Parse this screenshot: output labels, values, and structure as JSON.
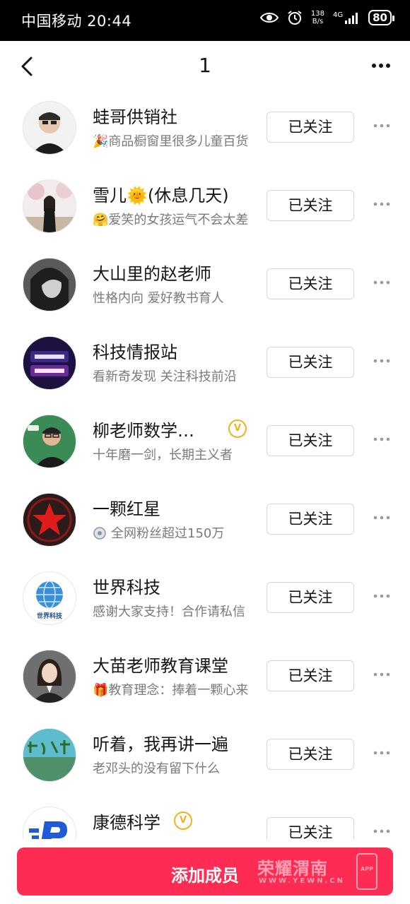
{
  "status_bar": {
    "carrier_time": "中国移动 20:44",
    "net_speed_value": "138",
    "net_speed_unit": "B/s",
    "net_type": "4G",
    "battery": "80"
  },
  "header": {
    "title": "1"
  },
  "accent_color": "#fe2c55",
  "users": [
    {
      "name": "蛙哥供销社",
      "desc": "🎉商品橱窗里很多儿童百货",
      "follow": "已关注",
      "avatar": "person-avatar"
    },
    {
      "name": "雪儿🌞(休息几天)",
      "desc": "🤗爱笑的女孩运气不会太差",
      "follow": "已关注",
      "avatar": "person-avatar"
    },
    {
      "name": "大山里的赵老师",
      "desc": "性格内向 爱好教书育人",
      "follow": "已关注",
      "avatar": "person-avatar"
    },
    {
      "name": "科技情报站",
      "desc": "看新奇发现 关注科技前沿",
      "follow": "已关注",
      "avatar": "tech-logo"
    },
    {
      "name": "柳老师数学…",
      "desc": "十年磨一剑，长期主义者",
      "follow": "已关注",
      "avatar": "person-avatar",
      "verified": "V"
    },
    {
      "name": "一颗红星",
      "desc": "全网粉丝超过150万",
      "follow": "已关注",
      "avatar": "red-star-logo"
    },
    {
      "name": "世界科技",
      "desc": "感谢大家支持！合作请私信",
      "follow": "已关注",
      "avatar": "globe-logo",
      "avatar_caption": "世界科技"
    },
    {
      "name": "大苗老师教育课堂",
      "desc": "🎁教育理念：捧着一颗心来",
      "follow": "已关注",
      "avatar": "person-avatar"
    },
    {
      "name": "听着，我再讲一遍",
      "desc": "老邓头的没有留下什么",
      "follow": "已关注",
      "avatar": "calligraphy-image"
    },
    {
      "name": "康德科学",
      "desc": "",
      "follow": "已关注",
      "avatar": "p-logo",
      "verified": "V"
    }
  ],
  "bottom": {
    "add_member_label": "添加成员",
    "watermark_title": "荣耀渭南",
    "watermark_sub": "WWW.YEWN.CN",
    "watermark_app": "APP"
  }
}
